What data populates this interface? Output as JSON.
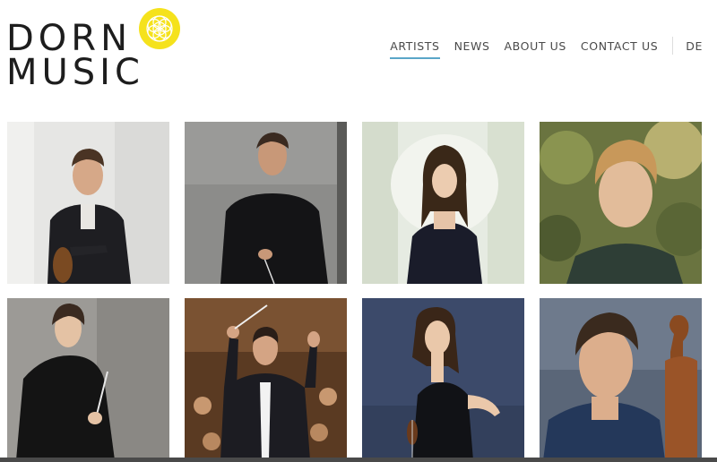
{
  "logo": {
    "line1": "DORN",
    "line2": "MUSIC",
    "emblem_icon": "flower-of-life-icon",
    "emblem_color": "#f5e21c"
  },
  "nav": {
    "items": [
      {
        "label": "ARTISTS",
        "active": true
      },
      {
        "label": "NEWS"
      },
      {
        "label": "ABOUT US"
      },
      {
        "label": "CONTACT US"
      }
    ],
    "language": "DE",
    "active_underline_color": "#5aa6c8"
  },
  "artists": {
    "tiles": [
      {
        "image": "portrait-violinist-smiling"
      },
      {
        "image": "portrait-conductor-black-sweater"
      },
      {
        "image": "portrait-woman-dark-dress"
      },
      {
        "image": "portrait-young-man-greenery"
      },
      {
        "image": "portrait-woman-conductor-baton"
      },
      {
        "image": "portrait-conductor-orchestra"
      },
      {
        "image": "portrait-woman-violinist"
      },
      {
        "image": "portrait-cellist"
      }
    ]
  }
}
